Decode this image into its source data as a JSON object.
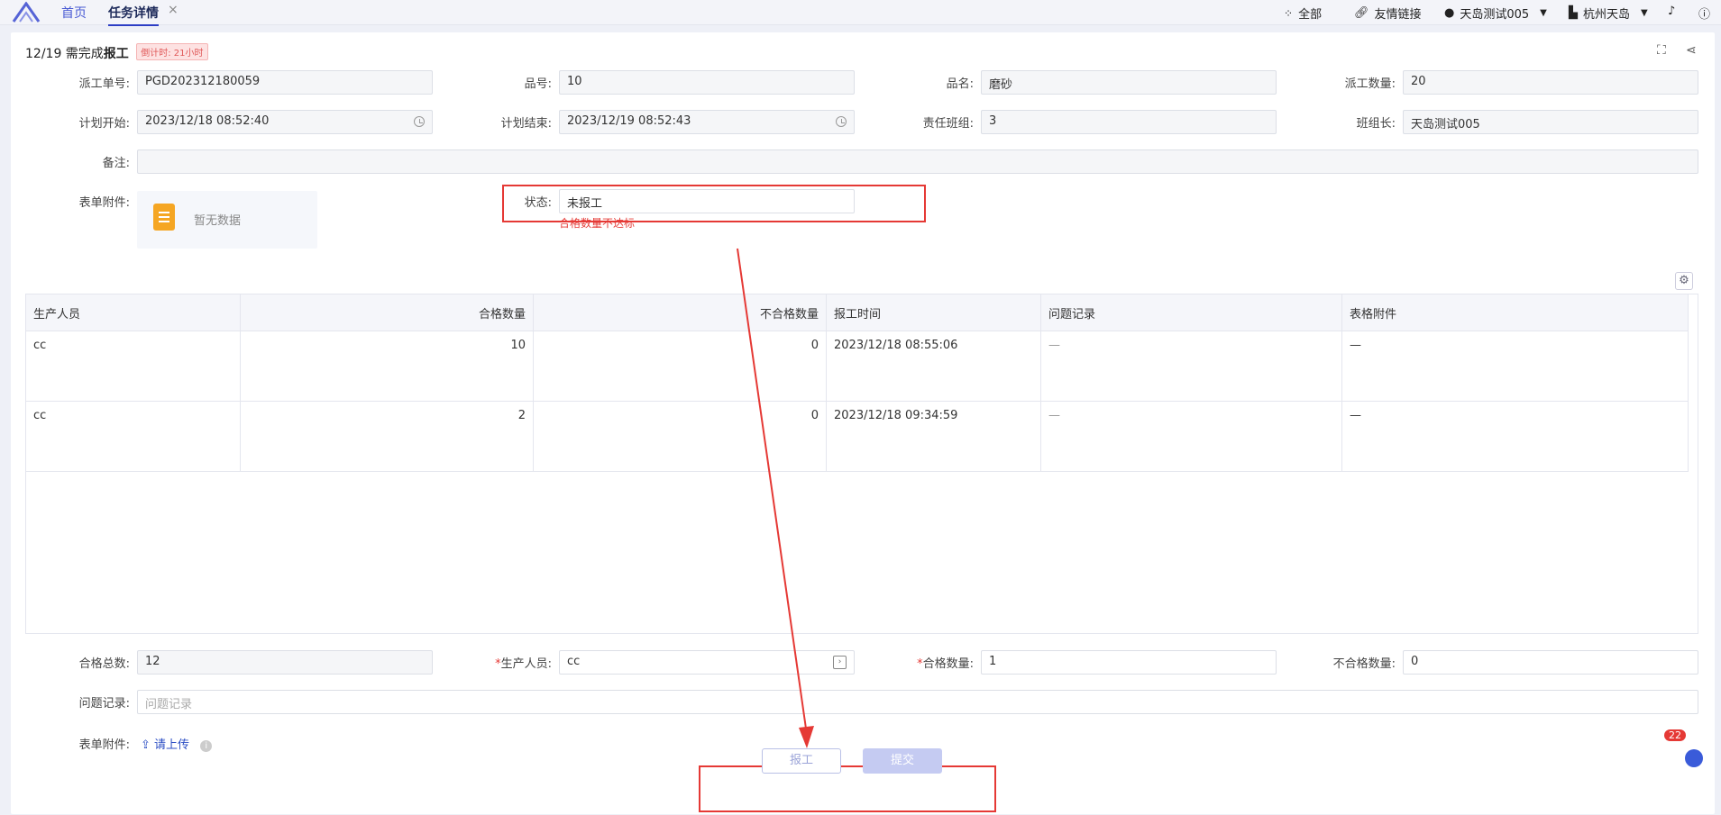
{
  "topbar": {
    "tabs": [
      {
        "label": "首页"
      },
      {
        "label": "任务详情"
      }
    ],
    "close_glyph": "×",
    "all_label": "全部",
    "links_label": "友情链接",
    "user_label": "天岛测试005",
    "org_label": "杭州天岛",
    "icons": [
      "grid-icon",
      "link-icon",
      "user-icon",
      "building-icon",
      "bell-icon",
      "help-icon"
    ]
  },
  "header": {
    "prefix": "12/19 需完成",
    "action": "报工",
    "countdown": "倒计时: 21小时"
  },
  "form": {
    "dispatch_no_label": "派工单号:",
    "dispatch_no": "PGD202312180059",
    "item_no_label": "品号:",
    "item_no": "10",
    "item_name_label": "品名:",
    "item_name": "磨砂",
    "dispatch_qty_label": "派工数量:",
    "dispatch_qty": "20",
    "plan_start_label": "计划开始:",
    "plan_start": "2023/12/18 08:52:40",
    "plan_end_label": "计划结束:",
    "plan_end": "2023/12/19 08:52:43",
    "team_label": "责任班组:",
    "team": "3",
    "leader_label": "班组长:",
    "leader": "天岛测试005",
    "remark_label": "备注:",
    "remark": "",
    "attach_label": "表单附件:",
    "attach_empty": "暂无数据",
    "status_label": "状态:",
    "status": "未报工",
    "status_error": "合格数量不达标"
  },
  "table": {
    "columns": [
      "生产人员",
      "合格数量",
      "不合格数量",
      "报工时间",
      "问题记录",
      "表格附件"
    ],
    "rows": [
      [
        "cc",
        "10",
        "0",
        "2023/12/18 08:55:06",
        "—",
        "—"
      ],
      [
        "cc",
        "2",
        "0",
        "2023/12/18 09:34:59",
        "—",
        "—"
      ]
    ]
  },
  "report": {
    "total_label": "合格总数:",
    "total": "12",
    "worker_label": "生产人员:",
    "worker": "cc",
    "qualified_label": "合格数量:",
    "qualified": "1",
    "unqualified_label": "不合格数量:",
    "unqualified": "0",
    "issue_label": "问题记录:",
    "issue_placeholder": "问题记录",
    "attach_label": "表单附件:",
    "upload_label": "请上传"
  },
  "buttons": {
    "report": "报工",
    "submit": "提交"
  },
  "notification_count": "22",
  "colors": {
    "accent": "#2d3ec4",
    "error": "#e53935",
    "annotation": "#e53935"
  }
}
